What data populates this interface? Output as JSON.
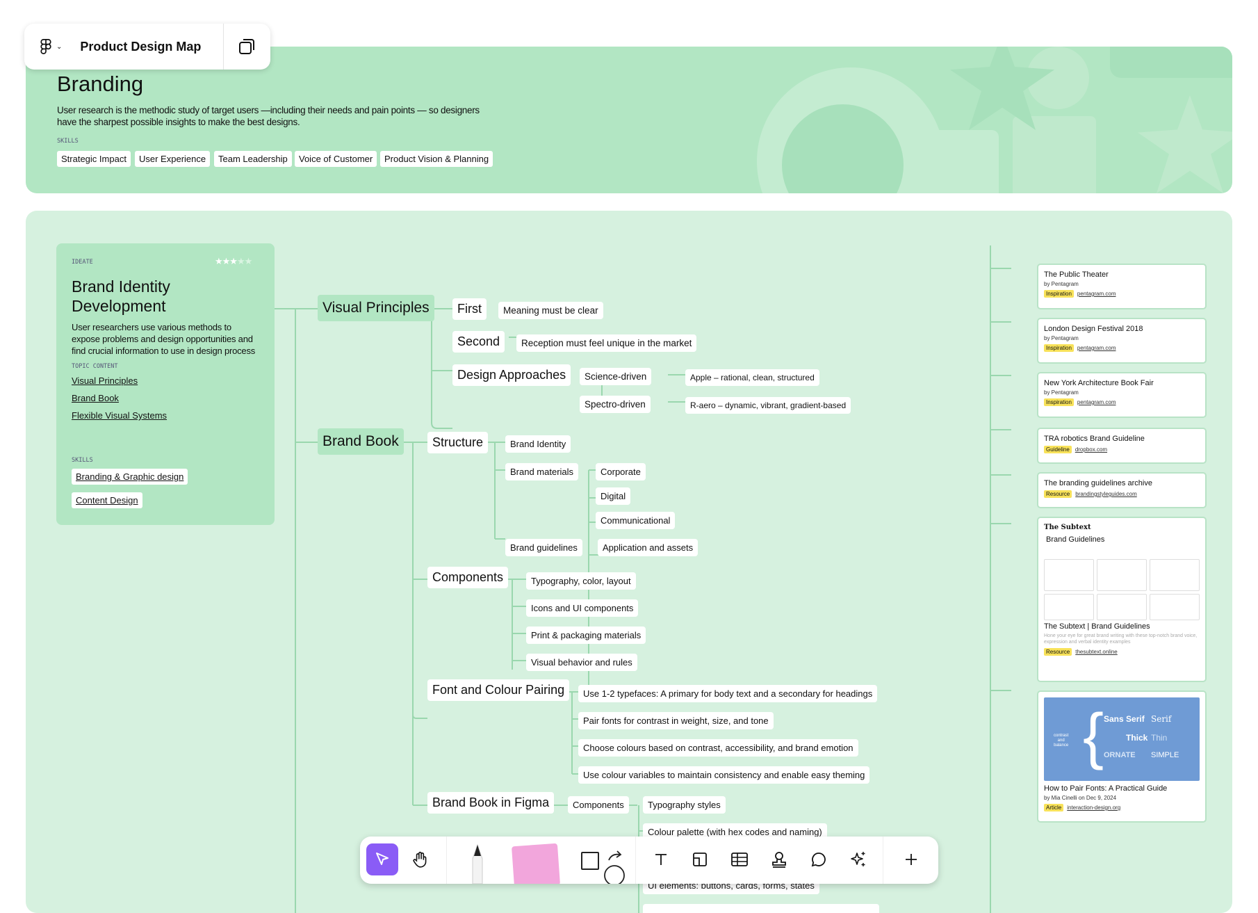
{
  "file_menu": {
    "title": "Product Design Map"
  },
  "header": {
    "title": "Branding",
    "description_line1": "User research is the methodic study of target users —including their needs and pain points — so designers",
    "description_line2": "have the sharpest possible insights to make the best designs.",
    "skills_label": "SKILLS",
    "skills": [
      "Strategic Impact",
      "User Experience",
      "Team Leadership",
      "Voice of Customer",
      "Product Vision & Planning"
    ]
  },
  "card": {
    "stage": "IDEATE",
    "rating": 3,
    "rating_max": 5,
    "title_line1": "Brand Identity",
    "title_line2": "Development",
    "desc_line1": "User researchers use various methods to",
    "desc_line2": "expose problems and design opportunities and",
    "desc_line3": "find crucial information to use in design process",
    "topic_label": "TOPIC CONTENT",
    "topics": [
      "Visual Principles",
      "Brand Book",
      "Flexible Visual Systems"
    ],
    "skills_label": "SKILLS",
    "skills": [
      "Branding & Graphic design",
      "Content Design"
    ]
  },
  "map": {
    "visual_principles": "Visual Principles",
    "first": "First",
    "first_note": "Meaning must be clear",
    "second": "Second",
    "second_note": "Reception must feel unique in the market",
    "design_approaches": "Design Approaches",
    "science": "Science-driven",
    "science_note": "Apple – rational, clean, structured",
    "spectro": "Spectro-driven",
    "spectro_note": "R-aero – dynamic, vibrant, gradient-based",
    "brand_book": "Brand Book",
    "structure": "Structure",
    "brand_identity": "Brand Identity",
    "brand_materials": "Brand materials",
    "corporate": "Corporate",
    "digital": "Digital",
    "communicational": "Communicational",
    "brand_guidelines": "Brand guidelines",
    "application_assets": "Application and assets",
    "components": "Components",
    "comp_typography": "Typography, color, layout",
    "comp_icons": "Icons and UI components",
    "comp_print": "Print & packaging materials",
    "comp_visual": "Visual behavior and rules",
    "font_pairing": "Font and Colour Pairing",
    "fp1": "Use 1-2 typefaces: A primary for body text and a secondary for headings",
    "fp2": "Pair fonts for contrast in weight, size, and tone",
    "fp3": "Choose colours based on contrast, accessibility, and brand emotion",
    "fp4": "Use colour variables to maintain consistency and enable easy theming",
    "brand_book_figma": "Brand Book in Figma",
    "figma_components": "Components",
    "typography_styles": "Typography styles",
    "colour_palette": "Colour palette (with hex codes and naming)",
    "ui_elements": "UI elements: buttons, cards, forms, states"
  },
  "resources": [
    {
      "title": "The Public Theater",
      "by": "by Pentagram",
      "tag": "Inspiration",
      "link": "pentagram.com"
    },
    {
      "title": "London Design Festival 2018",
      "by": "by Pentagram",
      "tag": "Inspiration",
      "link": "pentagram.com"
    },
    {
      "title": "New York Architecture Book Fair",
      "by": "by Pentagram",
      "tag": "Inspiration",
      "link": "pentagram.com"
    },
    {
      "title": "TRA robotics Brand Guideline",
      "tag": "Guideline",
      "link": "dropbox.com"
    },
    {
      "title": "The branding guidelines archive",
      "tag": "Resource",
      "link": "brandingstyleguides.com"
    }
  ],
  "subtext_card": {
    "logo": "The Subtext",
    "heading": "Brand Guidelines",
    "title": "The Subtext | Brand Guidelines",
    "desc": "Hone your eye for great brand writing with these top-notch brand voice, expression and verbal identity examples",
    "tag": "Resource",
    "link": "thesubtext.online"
  },
  "fonts_card": {
    "img_contrast": "contrast",
    "img_and": "and",
    "img_balance": "balance",
    "img_sans": "Sans Serif",
    "img_serif": "Serif",
    "img_thick": "Thick",
    "img_thin": "Thin",
    "img_ornate": "ORNATE",
    "img_simple": "SIMPLE",
    "title": "How to Pair Fonts: A Practical Guide",
    "by": "by Mia Cinelli on Dec 9, 2024",
    "tag": "Article",
    "link": "interaction-design.org"
  },
  "toolbar": {
    "tools": [
      "move",
      "hand",
      "pen",
      "sticky",
      "shape",
      "connector",
      "text",
      "section",
      "table",
      "stamp",
      "comment",
      "ai-actions",
      "more"
    ]
  },
  "colors": {
    "header_bg": "#b2e6c3",
    "canvas_bg": "#d6f1df",
    "accent": "#8a5cf6",
    "tag": "#f8e25a",
    "line": "#9ad7ae"
  }
}
